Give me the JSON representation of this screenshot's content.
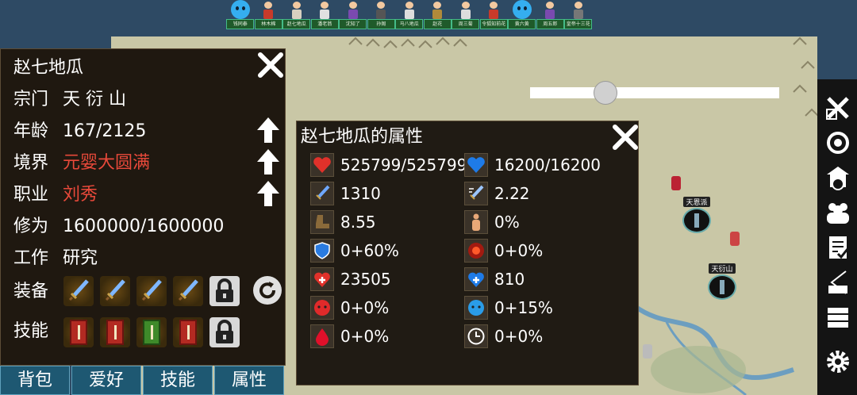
{
  "roster": [
    {
      "name": "钱同泰",
      "sprite": "slime-icon"
    },
    {
      "name": "林木棉",
      "sprite": "character-sprite"
    },
    {
      "name": "赵七地瓜",
      "sprite": "character-sprite"
    },
    {
      "name": "潘老翁",
      "sprite": "character-sprite"
    },
    {
      "name": "沈知了",
      "sprite": "character-sprite"
    },
    {
      "name": "孙阁",
      "sprite": "character-sprite"
    },
    {
      "name": "马八地瓜",
      "sprite": "character-sprite"
    },
    {
      "name": "赵花",
      "sprite": "character-sprite"
    },
    {
      "name": "周三菊",
      "sprite": "character-sprite"
    },
    {
      "name": "令狐知前花",
      "sprite": "character-sprite"
    },
    {
      "name": "黄六黄",
      "sprite": "slime-icon"
    },
    {
      "name": "周五郎",
      "sprite": "character-sprite"
    },
    {
      "name": "皇帝十三花",
      "sprite": "character-sprite"
    }
  ],
  "map": {
    "sects": [
      {
        "name": "天恩派"
      },
      {
        "name": "天衍山"
      }
    ]
  },
  "character": {
    "name": "赵七地瓜",
    "sect": {
      "label": "宗门",
      "value": "天 衍 山"
    },
    "age": {
      "label": "年龄",
      "value": "167/2125"
    },
    "realm": {
      "label": "境界",
      "value": "元婴大圆满"
    },
    "profession": {
      "label": "职业",
      "value": "刘秀"
    },
    "cultivation": {
      "label": "修为",
      "value": "1600000/1600000"
    },
    "work": {
      "label": "工作",
      "value": "研究"
    },
    "equipment": {
      "label": "装备"
    },
    "skills": {
      "label": "技能"
    }
  },
  "tabs": [
    "背包",
    "爱好",
    "技能",
    "属性"
  ],
  "attributes": {
    "title": "赵七地瓜的属性",
    "items": [
      {
        "icon": "heart-icon",
        "value": "525799/525799"
      },
      {
        "icon": "mana-heart-icon",
        "value": "16200/16200"
      },
      {
        "icon": "sword-icon",
        "value": "1310"
      },
      {
        "icon": "sword-speed-icon",
        "value": "2.22"
      },
      {
        "icon": "boot-icon",
        "value": "8.55"
      },
      {
        "icon": "body-icon",
        "value": "0%"
      },
      {
        "icon": "shield-icon",
        "value": "0+60%"
      },
      {
        "icon": "fire-shield-icon",
        "value": "0+0%"
      },
      {
        "icon": "heal-icon",
        "value": "23505"
      },
      {
        "icon": "mana-plus-icon",
        "value": "810"
      },
      {
        "icon": "red-face-icon",
        "value": "0+0%"
      },
      {
        "icon": "blue-face-icon",
        "value": "0+15%"
      },
      {
        "icon": "blood-drop-icon",
        "value": "0+0%"
      },
      {
        "icon": "clock-icon",
        "value": "0+0%"
      }
    ]
  },
  "colors": {
    "accent_red": "#e8493a",
    "tab_blue": "#1e5872",
    "panel_bg": "#1f1810"
  }
}
